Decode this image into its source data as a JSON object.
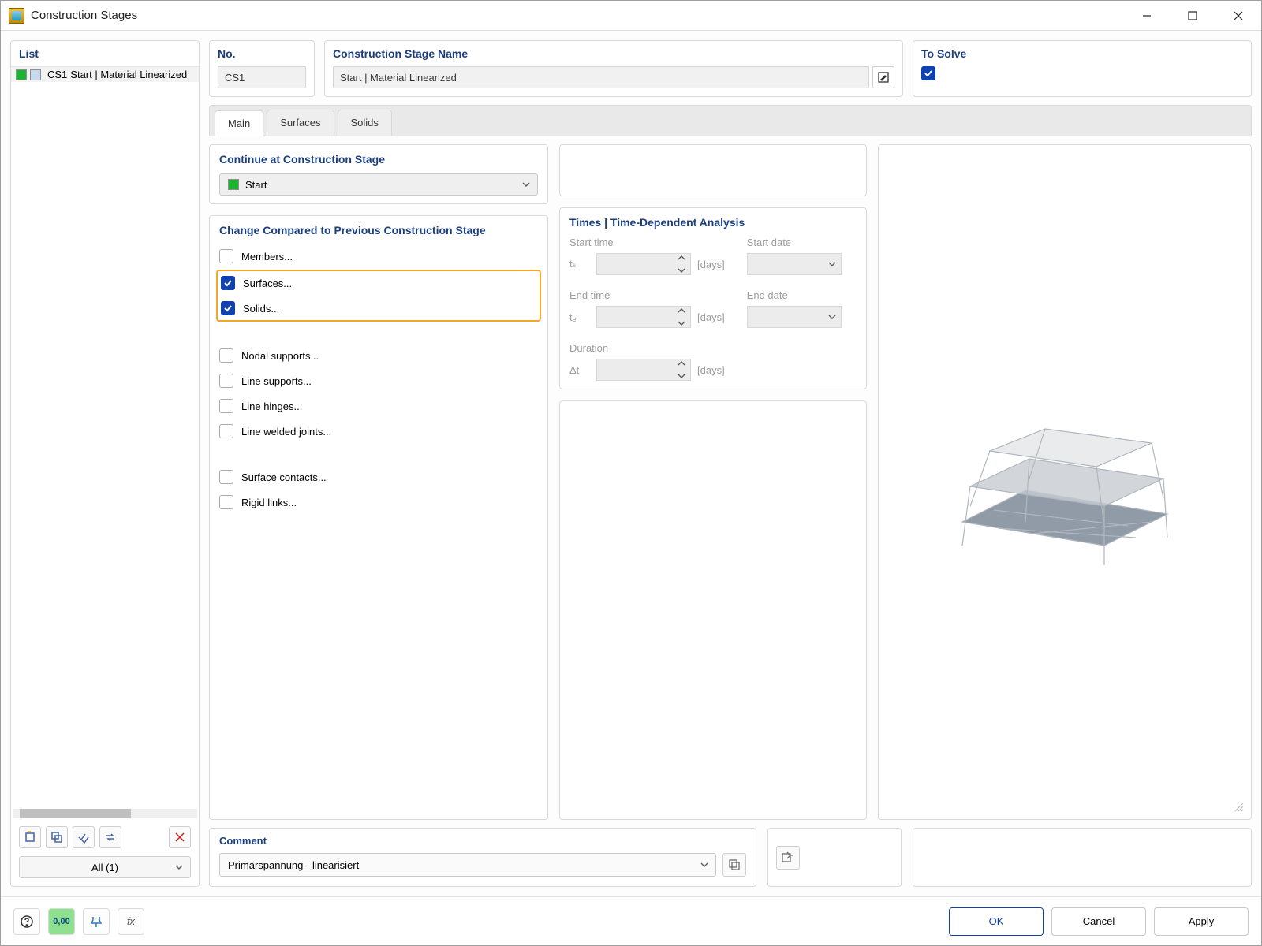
{
  "window": {
    "title": "Construction Stages"
  },
  "list": {
    "header": "List",
    "items": [
      {
        "code": "CS1",
        "name": "Start | Material Linearized"
      }
    ],
    "filter": "All (1)"
  },
  "no": {
    "label": "No.",
    "value": "CS1"
  },
  "stage_name": {
    "label": "Construction Stage Name",
    "value": "Start | Material Linearized"
  },
  "to_solve": {
    "label": "To Solve",
    "checked": true
  },
  "tabs": {
    "main": "Main",
    "surfaces": "Surfaces",
    "solids": "Solids"
  },
  "continue": {
    "header": "Continue at Construction Stage",
    "value": "Start"
  },
  "change": {
    "header": "Change Compared to Previous Construction Stage",
    "items": {
      "members": "Members...",
      "surfaces": "Surfaces...",
      "solids": "Solids...",
      "nodal_supports": "Nodal supports...",
      "line_supports": "Line supports...",
      "line_hinges": "Line hinges...",
      "line_welded_joints": "Line welded joints...",
      "surface_contacts": "Surface contacts...",
      "rigid_links": "Rigid links..."
    }
  },
  "times": {
    "header": "Times | Time-Dependent Analysis",
    "start_time_label": "Start time",
    "start_date_label": "Start date",
    "end_time_label": "End time",
    "end_date_label": "End date",
    "duration_label": "Duration",
    "sym_ts": "tₛ",
    "sym_te": "tₑ",
    "sym_dt": "Δt",
    "unit_days": "[days]"
  },
  "comment": {
    "label": "Comment",
    "value": "Primärspannung - linearisiert"
  },
  "footer": {
    "ok": "OK",
    "cancel": "Cancel",
    "apply": "Apply"
  }
}
